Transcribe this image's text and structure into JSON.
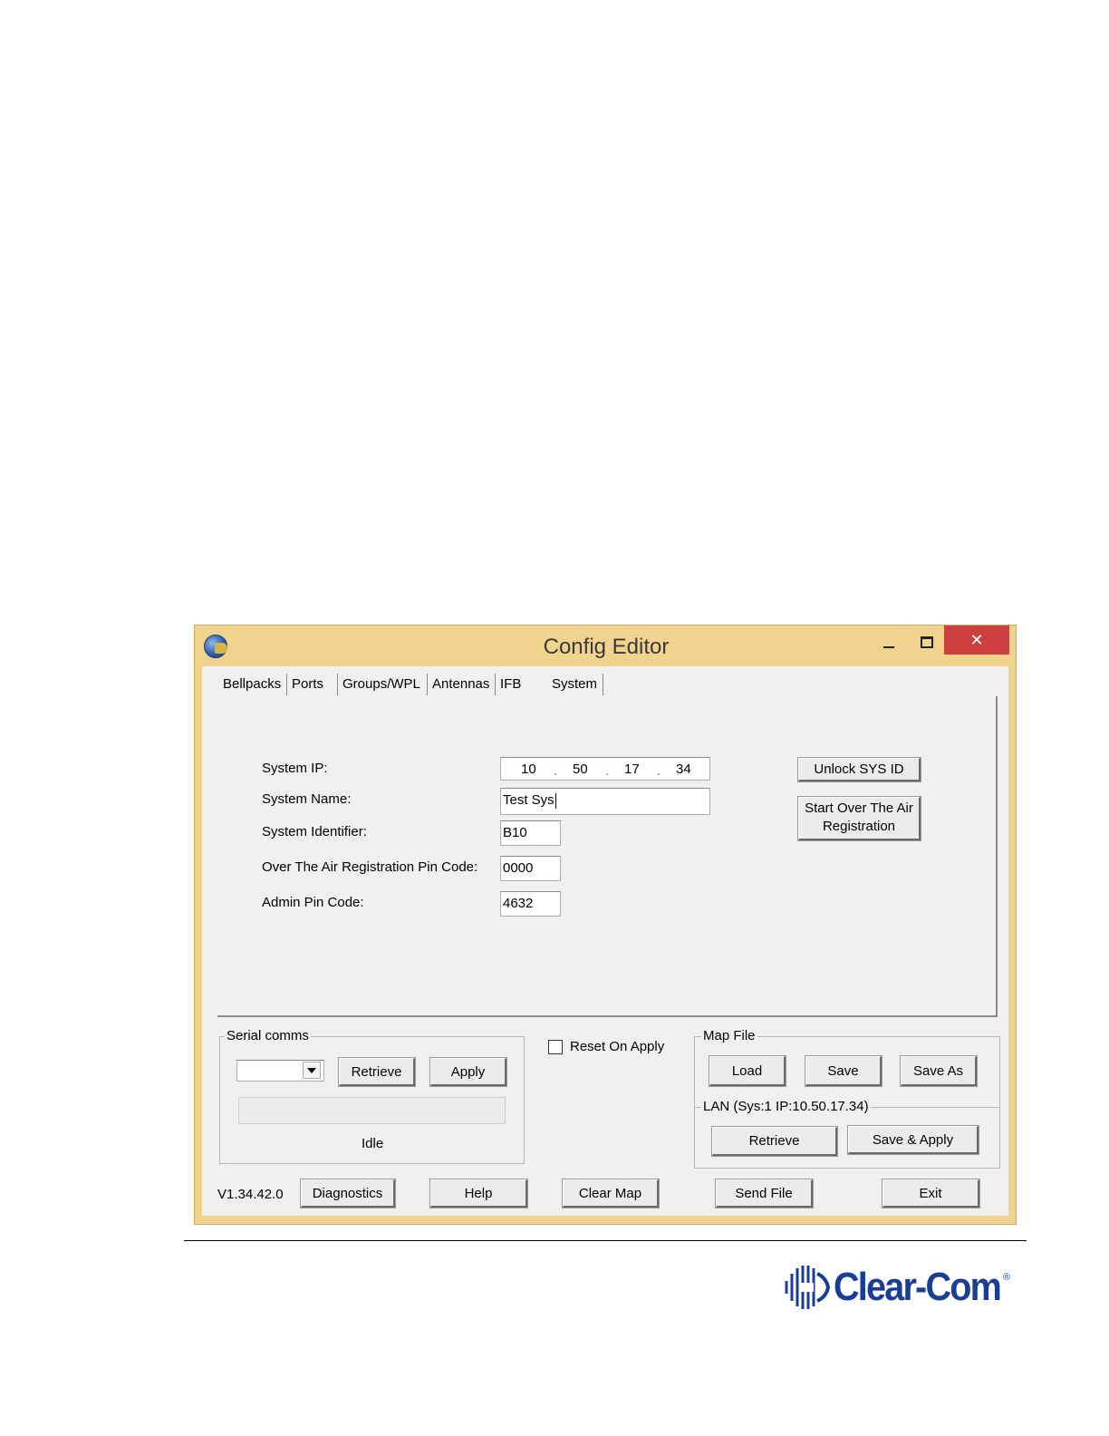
{
  "window": {
    "title": "Config Editor",
    "close_glyph": "✕"
  },
  "tabs": [
    {
      "label": "Bellpacks"
    },
    {
      "label": "Ports"
    },
    {
      "label": "Groups/WPL"
    },
    {
      "label": "Antennas"
    },
    {
      "label": "IFB"
    },
    {
      "label": "System",
      "selected": true
    }
  ],
  "system": {
    "ip_label": "System IP:",
    "ip": [
      "10",
      "50",
      "17",
      "34"
    ],
    "ip_dot": ".",
    "name_label": "System Name:",
    "name_value": "Test Sys",
    "identifier_label": "System Identifier:",
    "identifier_value": "B10",
    "ota_pin_label": "Over The Air Registration Pin Code:",
    "ota_pin_value": "0000",
    "admin_pin_label": "Admin Pin Code:",
    "admin_pin_value": "4632",
    "unlock_button": "Unlock SYS ID",
    "start_over_line1": "Start Over The Air",
    "start_over_line2": "Registration"
  },
  "serial": {
    "group_title": "Serial comms",
    "port_value": "",
    "retrieve": "Retrieve",
    "apply": "Apply",
    "status": "Idle"
  },
  "reset_on_apply": {
    "label": "Reset On Apply",
    "checked": false
  },
  "map_file": {
    "group_title": "Map File",
    "load": "Load",
    "save": "Save",
    "save_as": "Save As"
  },
  "lan": {
    "group_title": "LAN  (Sys:1 IP:10.50.17.34)",
    "retrieve": "Retrieve",
    "save_apply": "Save & Apply"
  },
  "bottom": {
    "version": "V1.34.42.0",
    "diagnostics": "Diagnostics",
    "help": "Help",
    "clear_map": "Clear Map",
    "send_file": "Send File",
    "exit": "Exit"
  },
  "brand": {
    "name": "Clear-Com",
    "reg": "®",
    "color": "#1a3e93"
  }
}
